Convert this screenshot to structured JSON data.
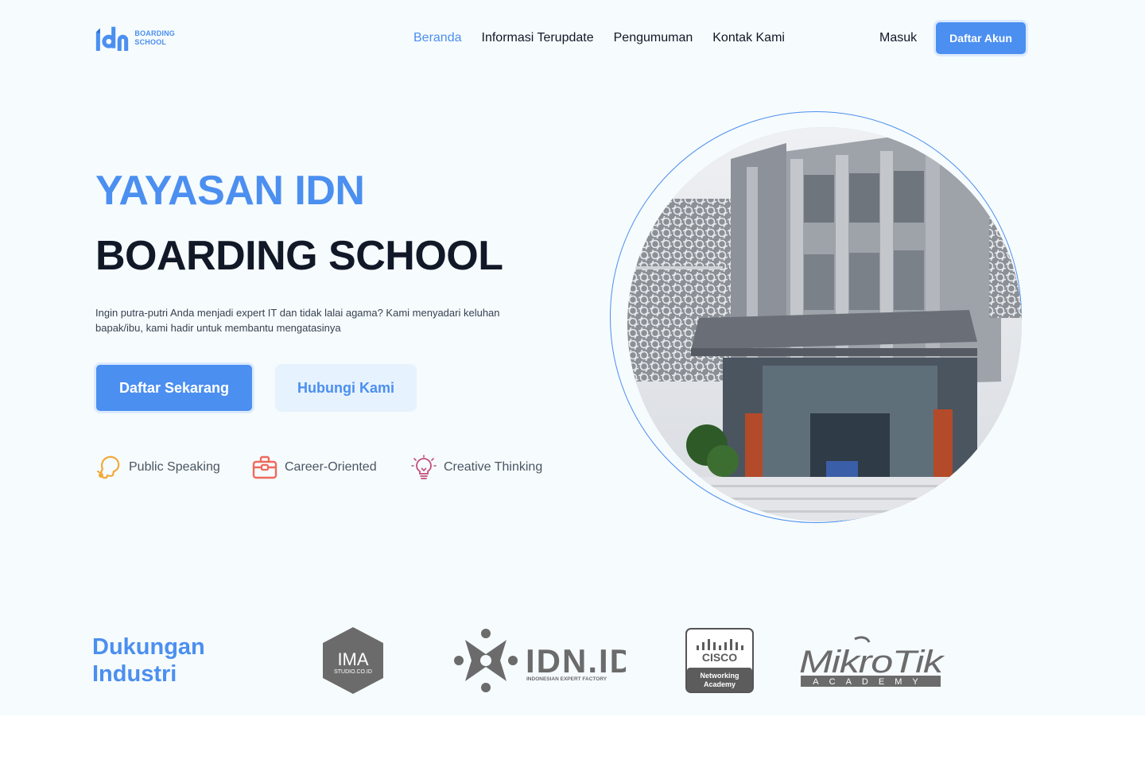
{
  "nav": {
    "logo_text_line1": "BOARDING",
    "logo_text_line2": "SCHOOL",
    "links": [
      {
        "label": "Beranda",
        "active": true
      },
      {
        "label": "Informasi Terupdate",
        "active": false
      },
      {
        "label": "Pengumuman",
        "active": false
      },
      {
        "label": "Kontak Kami",
        "active": false
      }
    ],
    "login_label": "Masuk",
    "register_label": "Daftar Akun"
  },
  "hero": {
    "title_line1": "YAYASAN IDN",
    "title_line2": "BOARDING SCHOOL",
    "description": "Ingin putra-putri Anda menjadi expert IT dan tidak lalai agama? Kami menyadari keluhan bapak/ibu, kami hadir untuk membantu mengatasinya",
    "primary_button": "Daftar Sekarang",
    "secondary_button": "Hubungi Kami",
    "features": [
      {
        "label": "Public Speaking",
        "icon": "head-speaking-icon"
      },
      {
        "label": "Career-Oriented",
        "icon": "briefcase-icon"
      },
      {
        "label": "Creative Thinking",
        "icon": "lightbulb-icon"
      }
    ]
  },
  "partners": {
    "title_line1": "Dukungan",
    "title_line2": "Industri",
    "logos": [
      {
        "name": "IMA",
        "subtext": "STUDIO.CO.ID"
      },
      {
        "name": "IDN.ID",
        "subtext": "INDONESIAN EXPERT FACTORY"
      },
      {
        "name": "CISCO",
        "subtext_line1": "Networking",
        "subtext_line2": "Academy"
      },
      {
        "name": "MikroTik",
        "subtext": "ACADEMY"
      }
    ]
  },
  "colors": {
    "accent": "#4b8ff0",
    "background": "#f6fbfd",
    "heading": "#111827"
  }
}
